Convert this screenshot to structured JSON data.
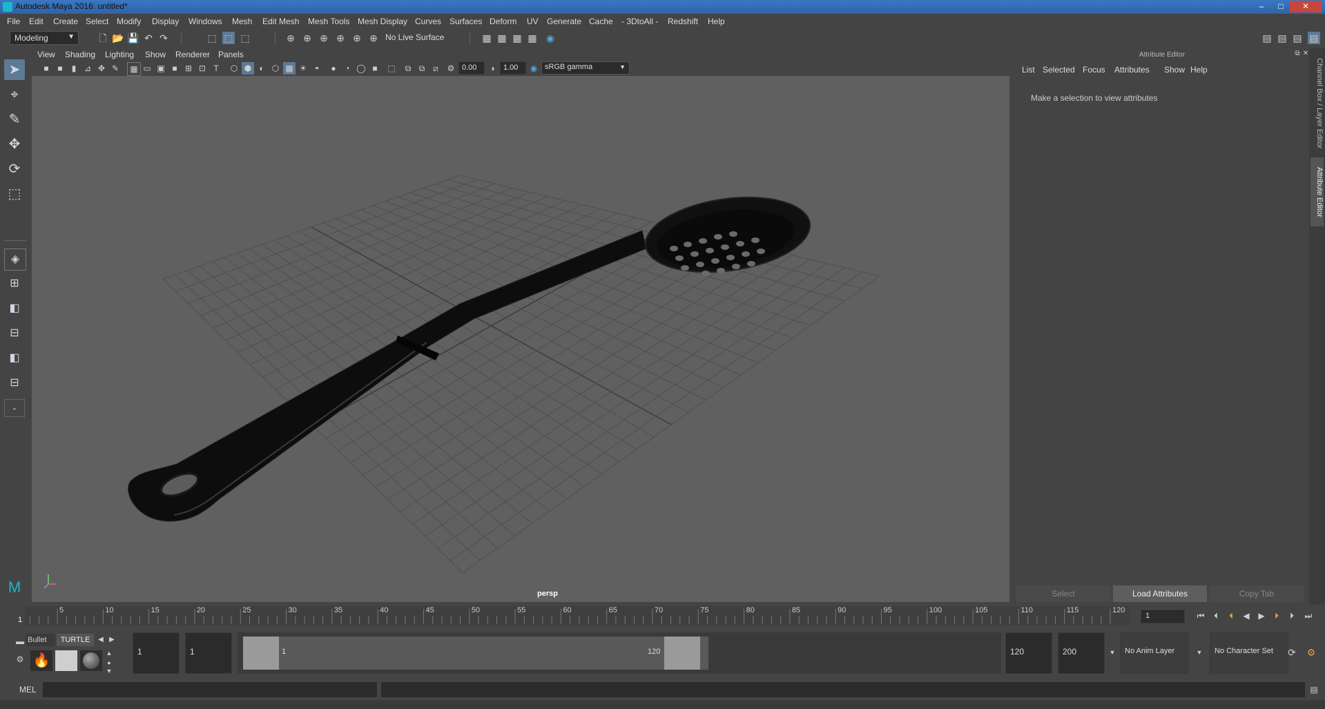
{
  "window": {
    "title": "Autodesk Maya 2016: untitled*",
    "minimize": "–",
    "maximize": "□",
    "close": "✕"
  },
  "menubar": [
    "File",
    "Edit",
    "Create",
    "Select",
    "Modify",
    "Display",
    "Windows",
    "Mesh",
    "Edit Mesh",
    "Mesh Tools",
    "Mesh Display",
    "Curves",
    "Surfaces",
    "Deform",
    "UV",
    "Generate",
    "Cache",
    "- 3DtoAll -",
    "Redshift",
    "Help"
  ],
  "statusline": {
    "menuset": "Modeling",
    "live_surface": "No Live Surface"
  },
  "panel": {
    "menus": [
      "View",
      "Shading",
      "Lighting",
      "Show",
      "Renderer",
      "Panels"
    ],
    "exposure": "0.00",
    "gamma": "1.00",
    "color_space": "sRGB gamma",
    "camera_label": "persp"
  },
  "attribute_editor": {
    "title": "Attribute Editor",
    "menus": [
      "List",
      "Selected",
      "Focus",
      "Attributes",
      "Show",
      "Help"
    ],
    "message": "Make a selection to view attributes",
    "buttons": {
      "select": "Select",
      "load": "Load Attributes",
      "copy": "Copy Tab"
    }
  },
  "side_tabs": {
    "channel_box": "Channel Box / Layer Editor",
    "attribute_editor": "Attribute Editor"
  },
  "time_slider": {
    "ticks": [
      "1",
      "5",
      "10",
      "15",
      "20",
      "25",
      "30",
      "35",
      "40",
      "45",
      "50",
      "55",
      "60",
      "65",
      "70",
      "75",
      "80",
      "85",
      "90",
      "95",
      "100",
      "105",
      "110",
      "115",
      "120"
    ],
    "current_frame": "1",
    "current_frame_field": "1"
  },
  "range_slider": {
    "shelf_tabs": [
      "Bullet",
      "TURTLE"
    ],
    "start_time": "1",
    "playback_start": "1",
    "range_start_label": "1",
    "range_end_label": "120",
    "playback_end": "120",
    "end_time": "200",
    "anim_layer": "No Anim Layer",
    "character_set": "No Character Set"
  },
  "command_line": {
    "label": "MEL"
  },
  "colors": {
    "title_bar": "#3a78c4",
    "viewport_bg": "#606060",
    "active_tool": "#5d7a96"
  }
}
